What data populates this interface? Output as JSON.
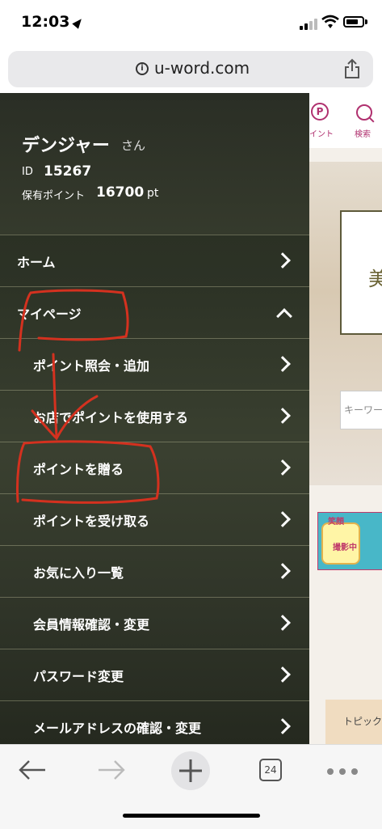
{
  "status_bar": {
    "time": "12:03"
  },
  "browser": {
    "url": "u-word.com",
    "info_icon": "i",
    "tab_count": "24"
  },
  "background_page": {
    "point_icon_glyph": "P",
    "point_label": "イント",
    "search_label": "検索",
    "hero_char": "美",
    "keyword_placeholder": "キーワー",
    "banner_text": "笑顔",
    "banner_sub": "撮影中",
    "topic_label": "トピック"
  },
  "drawer": {
    "user_name": "デンジャー",
    "honorific": "さん",
    "id_label": "ID",
    "id_value": "15267",
    "points_label": "保有ポイント",
    "points_value": "16700",
    "points_unit": "pt",
    "menu": [
      {
        "label": "ホーム"
      },
      {
        "label": "マイページ"
      },
      {
        "label": "ポイント照会・追加"
      },
      {
        "label": "お店でポイントを使用する"
      },
      {
        "label": "ポイントを贈る"
      },
      {
        "label": "ポイントを受け取る"
      },
      {
        "label": "お気に入り一覧"
      },
      {
        "label": "会員情報確認・変更"
      },
      {
        "label": "パスワード変更"
      },
      {
        "label": "メールアドレスの確認・変更"
      }
    ]
  },
  "colors": {
    "brand": "#b0316f",
    "annotation": "#d4311f",
    "drawer_bg": "#2d3326"
  }
}
